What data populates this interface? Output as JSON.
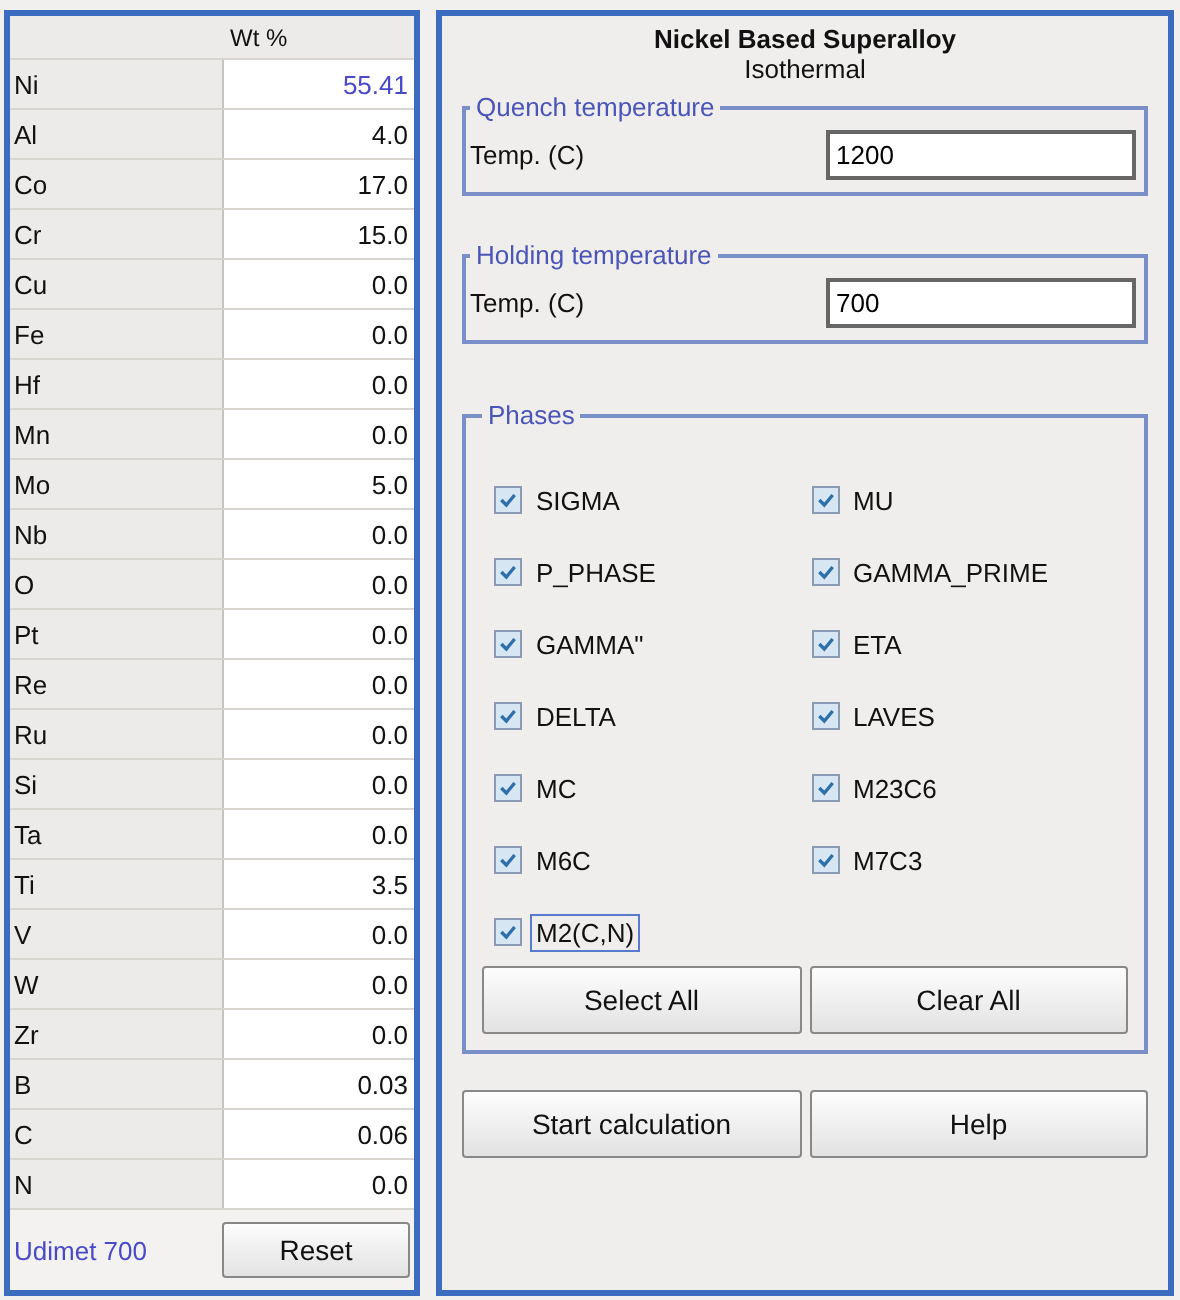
{
  "composition": {
    "header": "Wt %",
    "elements": [
      {
        "name": "Ni",
        "value": "55.41",
        "balance": true
      },
      {
        "name": "Al",
        "value": "4.0",
        "balance": false
      },
      {
        "name": "Co",
        "value": "17.0",
        "balance": false
      },
      {
        "name": "Cr",
        "value": "15.0",
        "balance": false
      },
      {
        "name": "Cu",
        "value": "0.0",
        "balance": false
      },
      {
        "name": "Fe",
        "value": "0.0",
        "balance": false
      },
      {
        "name": "Hf",
        "value": "0.0",
        "balance": false
      },
      {
        "name": "Mn",
        "value": "0.0",
        "balance": false
      },
      {
        "name": "Mo",
        "value": "5.0",
        "balance": false
      },
      {
        "name": "Nb",
        "value": "0.0",
        "balance": false
      },
      {
        "name": "O",
        "value": "0.0",
        "balance": false
      },
      {
        "name": "Pt",
        "value": "0.0",
        "balance": false
      },
      {
        "name": "Re",
        "value": "0.0",
        "balance": false
      },
      {
        "name": "Ru",
        "value": "0.0",
        "balance": false
      },
      {
        "name": "Si",
        "value": "0.0",
        "balance": false
      },
      {
        "name": "Ta",
        "value": "0.0",
        "balance": false
      },
      {
        "name": "Ti",
        "value": "3.5",
        "balance": false
      },
      {
        "name": "V",
        "value": "0.0",
        "balance": false
      },
      {
        "name": "W",
        "value": "0.0",
        "balance": false
      },
      {
        "name": "Zr",
        "value": "0.0",
        "balance": false
      },
      {
        "name": "B",
        "value": "0.03",
        "balance": false
      },
      {
        "name": "C",
        "value": "0.06",
        "balance": false
      },
      {
        "name": "N",
        "value": "0.0",
        "balance": false
      }
    ],
    "alloy_name": "Udimet 700",
    "reset_button": "Reset"
  },
  "settings": {
    "title": "Nickel Based Superalloy",
    "subtitle": "Isothermal",
    "quench": {
      "legend": "Quench temperature",
      "label": "Temp. (C)",
      "value": "1200"
    },
    "holding": {
      "legend": "Holding temperature",
      "label": "Temp. (C)",
      "value": "700"
    },
    "phases": {
      "legend": "Phases",
      "items": [
        {
          "label": "SIGMA",
          "checked": true,
          "focused": false
        },
        {
          "label": "MU",
          "checked": true,
          "focused": false
        },
        {
          "label": "P_PHASE",
          "checked": true,
          "focused": false
        },
        {
          "label": "GAMMA_PRIME",
          "checked": true,
          "focused": false
        },
        {
          "label": "GAMMA\"",
          "checked": true,
          "focused": false
        },
        {
          "label": "ETA",
          "checked": true,
          "focused": false
        },
        {
          "label": "DELTA",
          "checked": true,
          "focused": false
        },
        {
          "label": "LAVES",
          "checked": true,
          "focused": false
        },
        {
          "label": "MC",
          "checked": true,
          "focused": false
        },
        {
          "label": "M23C6",
          "checked": true,
          "focused": false
        },
        {
          "label": "M6C",
          "checked": true,
          "focused": false
        },
        {
          "label": "M7C3",
          "checked": true,
          "focused": false
        },
        {
          "label": "M2(C,N)",
          "checked": true,
          "focused": true
        }
      ],
      "buttons": [
        "Select All",
        "Clear All"
      ]
    },
    "buttons": [
      "Start calculation",
      "Help"
    ]
  }
}
